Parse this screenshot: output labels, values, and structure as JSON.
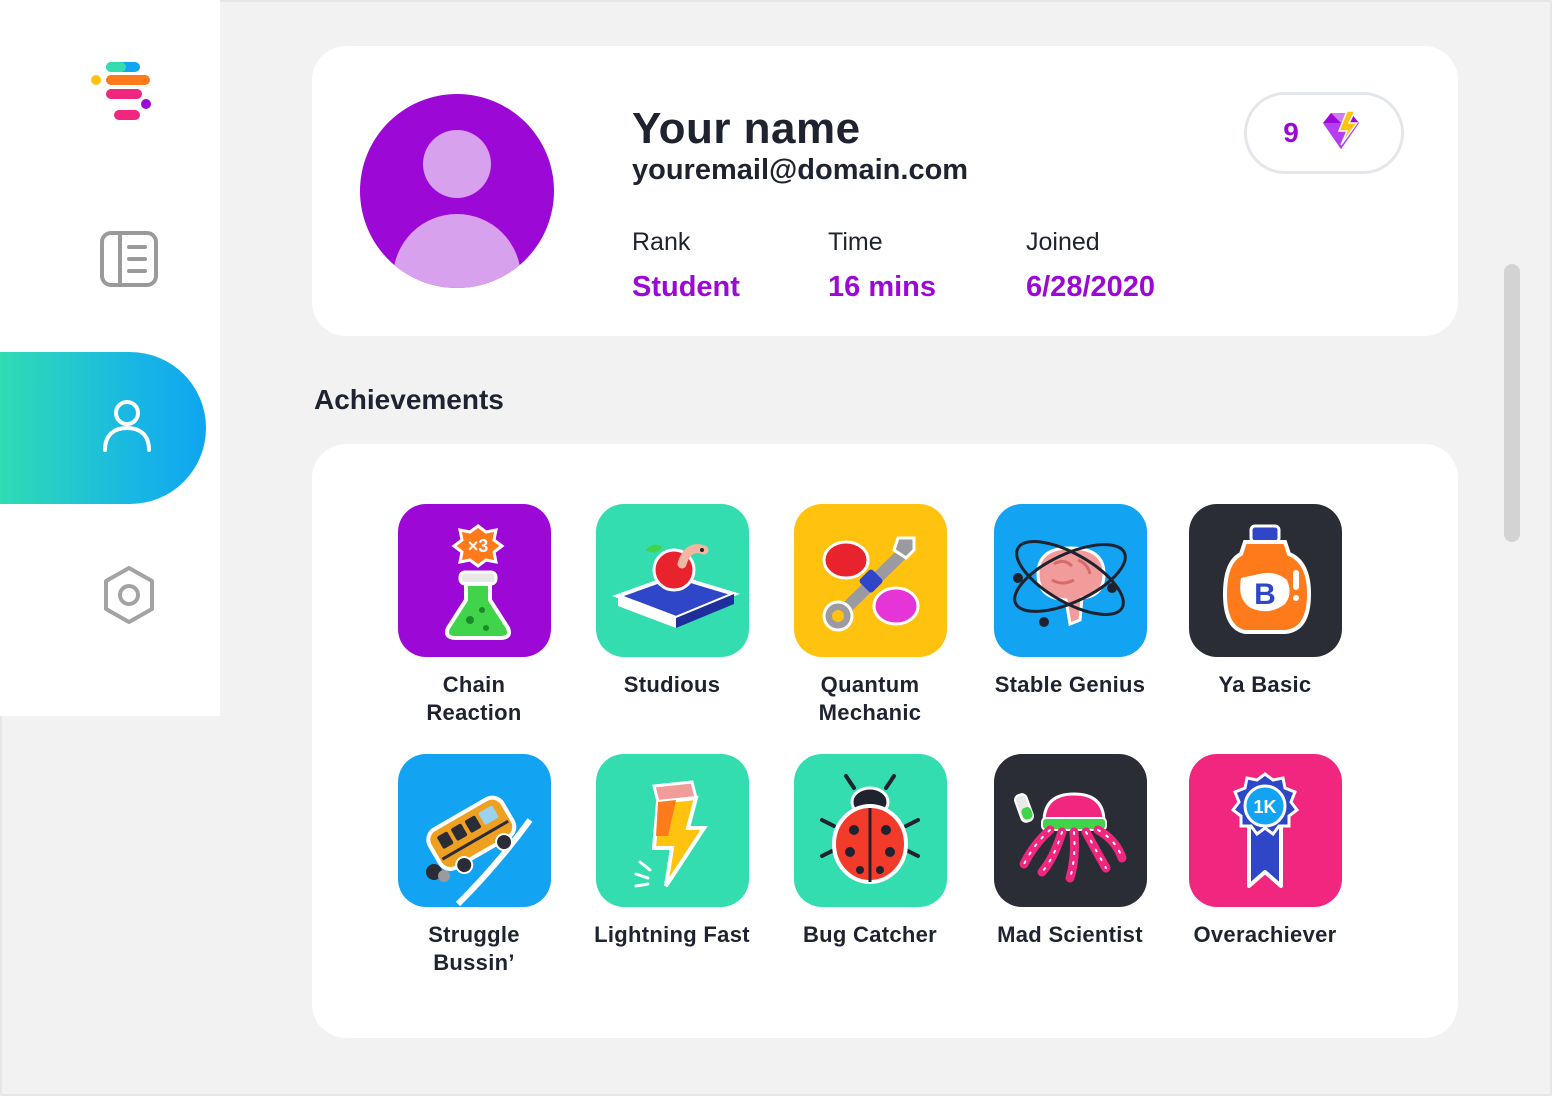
{
  "app": {
    "logo": "app-logo-icon",
    "nav": [
      {
        "name": "dashboard",
        "icon": "dashboard-icon"
      },
      {
        "name": "profile",
        "icon": "user-icon",
        "active": true
      },
      {
        "name": "settings",
        "icon": "settings-icon"
      }
    ]
  },
  "profile": {
    "name": "Your name",
    "email": "youremail@domain.com",
    "rank_label": "Rank",
    "rank_value": "Student",
    "time_label": "Time",
    "time_value": "16 mins",
    "joined_label": "Joined",
    "joined_value": "6/28/2020",
    "gems_count": "9",
    "gems_icon": "gem-icon"
  },
  "achievements": {
    "title": "Achievements",
    "items": [
      {
        "label": "Chain\nReaction",
        "icon": "flask-icon",
        "color": "#9c08d6"
      },
      {
        "label": "Studious",
        "icon": "apple-book-icon",
        "color": "#33ddb0"
      },
      {
        "label": "Quantum\nMechanic",
        "icon": "wrench-icon",
        "color": "#ffc20e"
      },
      {
        "label": "Stable Genius",
        "icon": "brain-atom-icon",
        "color": "#12a3f2"
      },
      {
        "label": "Ya Basic",
        "icon": "bottle-icon",
        "color": "#2a2d35"
      },
      {
        "label": "Struggle\nBussin’",
        "icon": "school-bus-icon",
        "color": "#12a3f2"
      },
      {
        "label": "Lightning Fast",
        "icon": "lightning-pencil-icon",
        "color": "#33ddb0"
      },
      {
        "label": "Bug Catcher",
        "icon": "ladybug-icon",
        "color": "#33ddb0"
      },
      {
        "label": "Mad Scientist",
        "icon": "octopus-icon",
        "color": "#2a2d35"
      },
      {
        "label": "Overachiever",
        "icon": "ribbon-icon",
        "color": "#f0267f"
      }
    ]
  },
  "colors": {
    "accent": "#9c08d6",
    "background": "#f2f2f2",
    "card": "#ffffff",
    "text": "#1f2330",
    "nav_gradient_start": "#2fdcb4",
    "nav_gradient_end": "#0ea5f0"
  }
}
